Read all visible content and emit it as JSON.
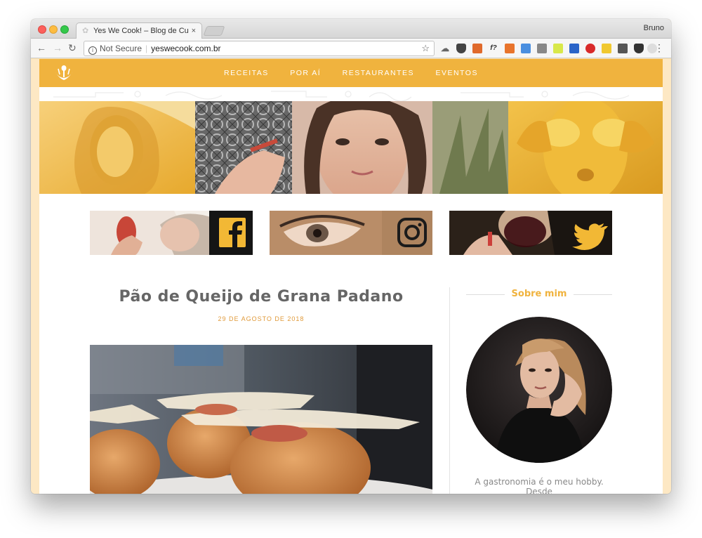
{
  "browser": {
    "tab_title": "Yes We Cook! – Blog de Culinária",
    "tab_close": "×",
    "profile_name": "Bruno",
    "security_label": "Not Secure",
    "url": "yeswecook.com.br"
  },
  "site": {
    "accent_color": "#f0b33e",
    "nav": {
      "items": [
        "RECEITAS",
        "POR AÍ",
        "RESTAURANTES",
        "EVENTOS"
      ]
    },
    "socials": {
      "facebook_icon": "facebook-icon",
      "instagram_icon": "instagram-icon",
      "twitter_icon": "twitter-icon"
    },
    "post": {
      "title": "Pão de Queijo de Grana Padano",
      "date": "29 DE AGOSTO DE 2018"
    },
    "sidebar": {
      "heading": "Sobre mim",
      "about_text": "A gastronomia é o meu hobby. Desde"
    }
  }
}
